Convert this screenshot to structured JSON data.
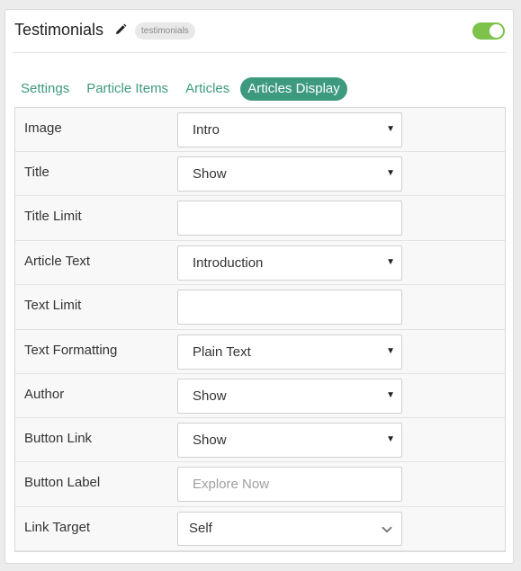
{
  "header": {
    "title": "Testimonials",
    "badge": "testimonials",
    "edit_icon": "pencil-icon",
    "toggle_on": true
  },
  "tabs": [
    {
      "label": "Settings",
      "active": false
    },
    {
      "label": "Particle Items",
      "active": false
    },
    {
      "label": "Articles",
      "active": false
    },
    {
      "label": "Articles Display",
      "active": true
    }
  ],
  "fields": [
    {
      "label": "Image",
      "type": "select",
      "value": "Intro"
    },
    {
      "label": "Title",
      "type": "select",
      "value": "Show"
    },
    {
      "label": "Title Limit",
      "type": "input",
      "value": ""
    },
    {
      "label": "Article Text",
      "type": "select",
      "value": "Introduction"
    },
    {
      "label": "Text Limit",
      "type": "input",
      "value": ""
    },
    {
      "label": "Text Formatting",
      "type": "select",
      "value": "Plain Text"
    },
    {
      "label": "Author",
      "type": "select",
      "value": "Show"
    },
    {
      "label": "Button Link",
      "type": "select",
      "value": "Show"
    },
    {
      "label": "Button Label",
      "type": "input",
      "value": "",
      "placeholder": "Explore Now"
    },
    {
      "label": "Link Target",
      "type": "dropdown",
      "value": "Self"
    }
  ],
  "colors": {
    "accent": "#3d9a7f",
    "toggle": "#7dc24a"
  }
}
